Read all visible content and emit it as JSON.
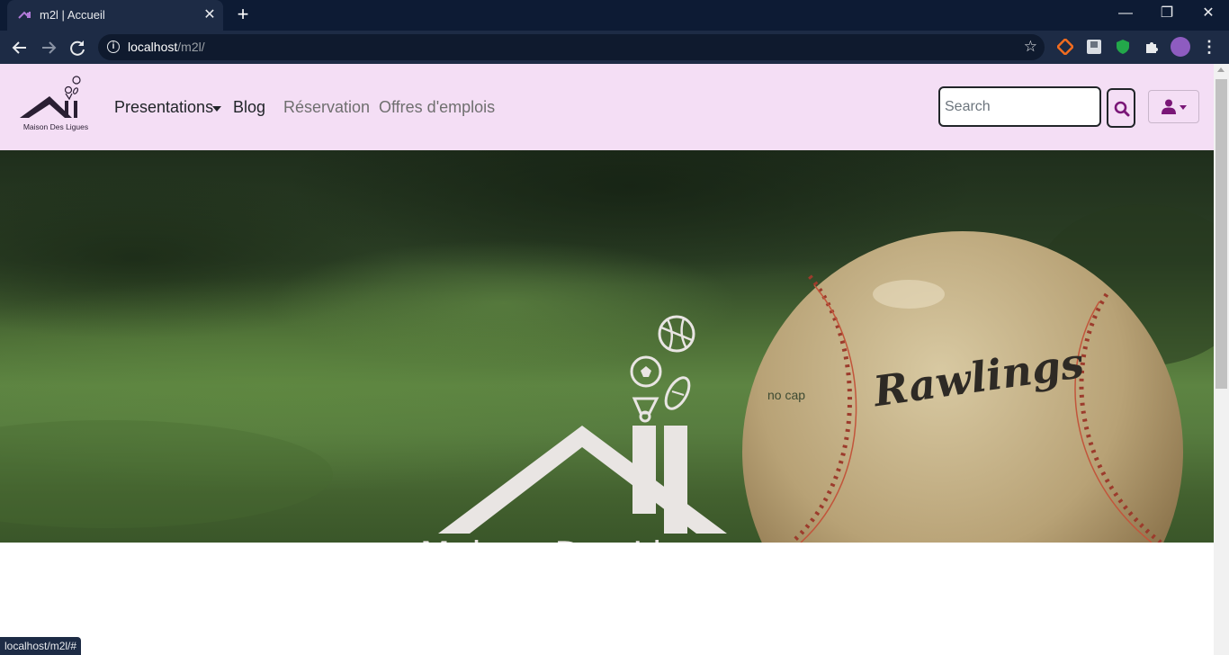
{
  "browser": {
    "tab_title": "m2l | Accueil",
    "new_tab_glyph": "+",
    "close_tab_glyph": "✕",
    "window_controls": {
      "minimize": "—",
      "maximize": "❐",
      "close": "✕"
    },
    "url_host": "localhost",
    "url_path": "/m2l/",
    "star_glyph": "☆",
    "menu_glyph": "⋮",
    "status_url": "localhost/m2l/#",
    "extensions": [
      "honey-extension-icon",
      "page-extension-icon",
      "shield-extension-icon",
      "puzzle-extensions-icon"
    ]
  },
  "navbar": {
    "brand_text": "Maison Des Ligues",
    "links": {
      "presentations": "Presentations",
      "blog": "Blog",
      "reservation": "Réservation",
      "offres": "Offres d'emplois"
    },
    "search_placeholder": "Search",
    "accent_color": "#7a1677",
    "background_color": "#f4def5"
  },
  "hero": {
    "logo_title": "Maison Des Ligues",
    "caption": "no cap",
    "ball_brand": "Rawlings"
  }
}
